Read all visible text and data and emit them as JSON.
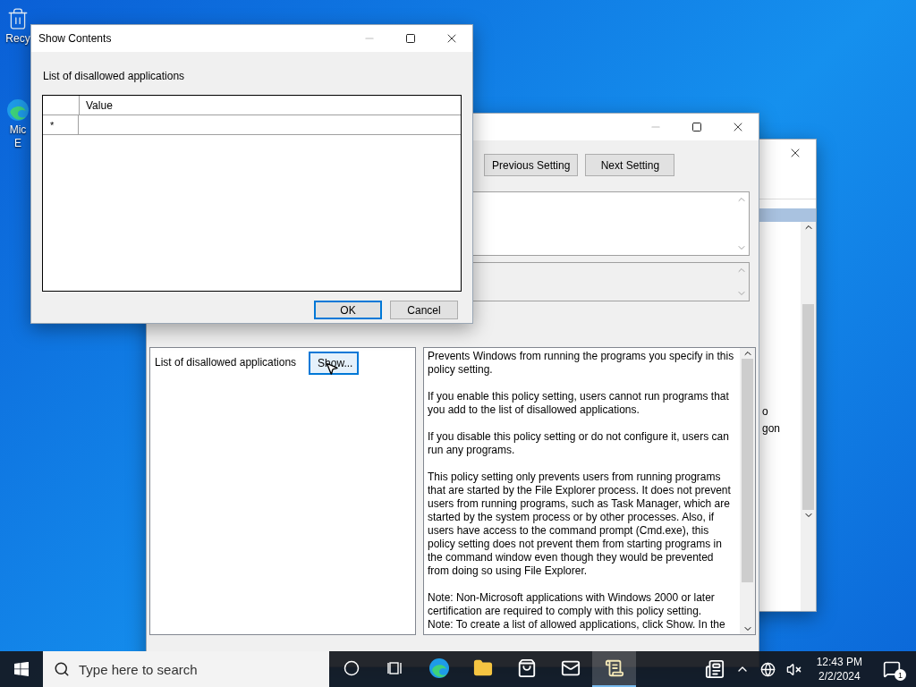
{
  "desktop_icons": [
    {
      "kind": "recycle",
      "label": "Recy"
    },
    {
      "kind": "edge",
      "label": "Mic\nE"
    }
  ],
  "back_window": {
    "items": [
      {
        "text": "o"
      },
      {
        "text": "gon"
      }
    ]
  },
  "policy_window": {
    "buttons": [
      "Previous Setting",
      "Next Setting"
    ],
    "option": {
      "label": "List of disallowed applications",
      "button": "Show..."
    },
    "help": [
      [
        "Prevents Windows from running the programs you specify in this policy setting."
      ],
      [
        "If you enable this policy setting, users cannot run programs that you add to the list of disallowed applications."
      ],
      [
        "If you disable this policy setting or do not configure it, users can run any programs."
      ],
      [
        "This policy setting only prevents users from running programs that are started by the File Explorer process. It does not prevent users from running programs, such as Task Manager, which are started by the system process or by other processes.  Also, if users have access to the command prompt (Cmd.exe), this policy setting does not prevent them from starting programs in the command window even though they would be prevented from doing so using File Explorer."
      ],
      [
        "Note: Non-Microsoft applications with Windows 2000 or later certification are required to comply with this policy setting.",
        "Note: To create a list of allowed applications, click Show.  In the"
      ]
    ]
  },
  "dialog": {
    "title": "Show Contents",
    "label": "List of disallowed applications",
    "columns": [
      "Value"
    ],
    "new_row_marker": "*",
    "buttons": [
      {
        "label": "OK",
        "default": true
      },
      {
        "label": "Cancel",
        "default": false
      }
    ]
  },
  "taskbar": {
    "search": {
      "placeholder": "Type here to search"
    },
    "apps": [
      {
        "kind": "cortana",
        "selected": false
      },
      {
        "kind": "taskview",
        "selected": false
      },
      {
        "kind": "edge",
        "selected": false
      },
      {
        "kind": "folder",
        "selected": false
      },
      {
        "kind": "store",
        "selected": false
      },
      {
        "kind": "mail",
        "selected": false
      },
      {
        "kind": "notepad",
        "selected": true
      }
    ],
    "time": "12:43 PM",
    "date": "2/2/2024",
    "notifications": "1"
  }
}
